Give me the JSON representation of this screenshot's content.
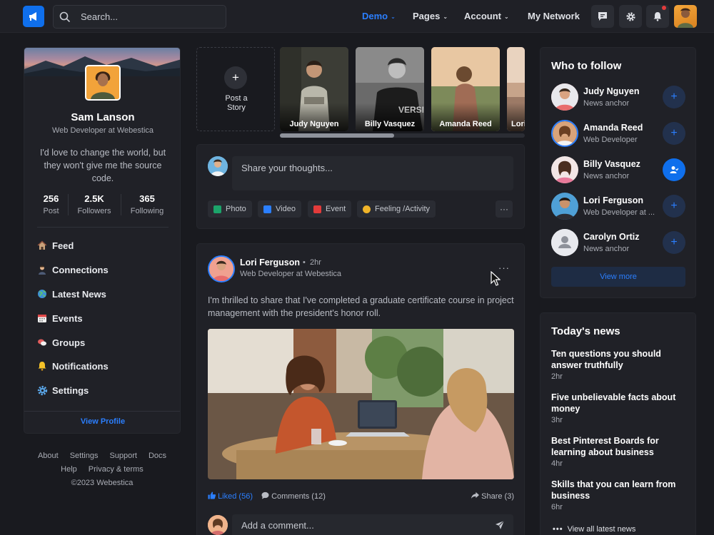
{
  "navbar": {
    "search_placeholder": "Search...",
    "links": [
      {
        "label": "Demo",
        "caret": "⌄"
      },
      {
        "label": "Pages",
        "caret": "⌄"
      },
      {
        "label": "Account",
        "caret": "⌄"
      },
      {
        "label": "My Network",
        "caret": ""
      }
    ],
    "accent": "#0f6fec"
  },
  "profile": {
    "name": "Sam Lanson",
    "role": "Web Developer at Webestica",
    "bio": "I'd love to change the world, but they won't give me the source code.",
    "stats": [
      {
        "value": "256",
        "label": "Post"
      },
      {
        "value": "2.5K",
        "label": "Followers"
      },
      {
        "value": "365",
        "label": "Following"
      }
    ],
    "menu": [
      {
        "label": "Feed",
        "icon": "home-icon"
      },
      {
        "label": "Connections",
        "icon": "person-icon"
      },
      {
        "label": "Latest News",
        "icon": "globe-icon"
      },
      {
        "label": "Events",
        "icon": "calendar-icon"
      },
      {
        "label": "Groups",
        "icon": "chat-icon"
      },
      {
        "label": "Notifications",
        "icon": "bell-icon"
      },
      {
        "label": "Settings",
        "icon": "gear-icon"
      }
    ],
    "view_profile": "View Profile"
  },
  "footer": {
    "links_row1": [
      "About",
      "Settings",
      "Support",
      "Docs"
    ],
    "links_row2": [
      "Help",
      "Privacy & terms"
    ],
    "copyright": "©2023 Webestica"
  },
  "stories": {
    "post_story_line1": "Post a",
    "post_story_line2": "Story",
    "items": [
      {
        "name": "Judy Nguyen"
      },
      {
        "name": "Billy Vasquez"
      },
      {
        "name": "Amanda Reed"
      },
      {
        "name": "Lori"
      }
    ]
  },
  "composer": {
    "placeholder": "Share your thoughts...",
    "actions": [
      {
        "label": "Photo",
        "color": "#1ca46a"
      },
      {
        "label": "Video",
        "color": "#2b7fff"
      },
      {
        "label": "Event",
        "color": "#e33b3b"
      },
      {
        "label": "Feeling /Activity",
        "color": "#f0b429"
      }
    ],
    "more": "···"
  },
  "post": {
    "author": "Lori Ferguson",
    "time": "2hr",
    "role": "Web Developer at Webestica",
    "text": "I'm thrilled to share that I've completed a graduate certificate course in project management with the president's honor roll.",
    "liked": "Liked (56)",
    "comments": "Comments (12)",
    "share": "Share (3)",
    "comment_placeholder": "Add a comment...",
    "more": "···"
  },
  "follow": {
    "title": "Who to follow",
    "people": [
      {
        "name": "Judy Nguyen",
        "role": "News anchor",
        "following": false
      },
      {
        "name": "Amanda Reed",
        "role": "Web Developer",
        "following": false
      },
      {
        "name": "Billy Vasquez",
        "role": "News anchor",
        "following": true
      },
      {
        "name": "Lori Ferguson",
        "role": "Web Developer at ...",
        "following": false
      },
      {
        "name": "Carolyn Ortiz",
        "role": "News anchor",
        "following": false
      }
    ],
    "view_more": "View more"
  },
  "news": {
    "title": "Today's news",
    "items": [
      {
        "title": "Ten questions you should answer truthfully",
        "time": "2hr"
      },
      {
        "title": "Five unbelievable facts about money",
        "time": "3hr"
      },
      {
        "title": "Best Pinterest Boards for learning about business",
        "time": "4hr"
      },
      {
        "title": "Skills that you can learn from business",
        "time": "6hr"
      }
    ],
    "view_all": "View all latest news"
  }
}
